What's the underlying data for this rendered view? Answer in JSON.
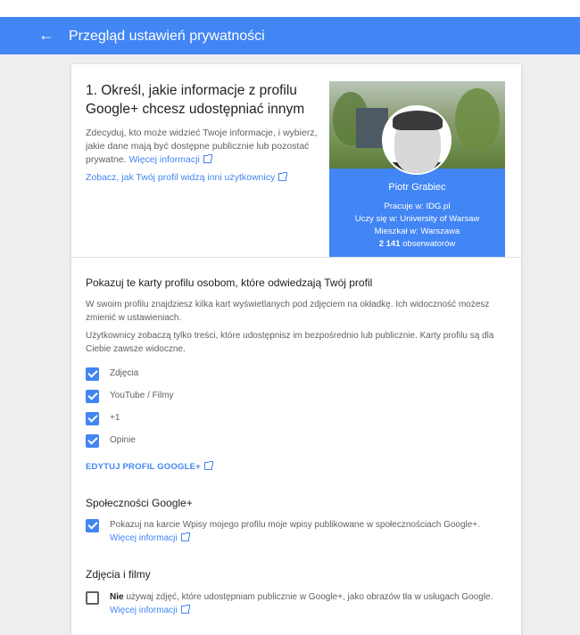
{
  "header": {
    "back_icon": "arrow-left-icon",
    "title": "Przegląd ustawień prywatności",
    "color": "#4285f4"
  },
  "section1": {
    "title": "1. Określ, jakie informacje z profilu Google+ chcesz udostępniać innym",
    "description": "Zdecyduj, kto może widzieć Twoje informacje, i wybierz, jakie dane mają być dostępne publicznie lub pozostać prywatne.",
    "more_link": "Więcej informacji",
    "view_link": "Zobacz, jak Twój profil widzą inni użytkownicy"
  },
  "profile_card": {
    "name": "Piotr Grabiec",
    "work": "Pracuje w: IDG.pl",
    "school": "Uczy się w: University of Warsaw",
    "lives": "Mieszkał w: Warszawa",
    "followers_count": "2 141",
    "followers_label": "obserwatorów"
  },
  "section2": {
    "title": "Pokazuj te karty profilu osobom, które odwiedzają Twój profil",
    "para1": "W swoim profilu znajdziesz kilka kart wyświetlanych pod zdjęciem na okładkę. Ich widoczność możesz zmienić w ustawieniach.",
    "para2": "Użytkownicy zobaczą tylko treści, które udostępnisz im bezpośrednio lub publicznie. Karty profilu są dla Ciebie zawsze widoczne.",
    "checkboxes": [
      {
        "label": "Zdjęcia",
        "checked": true
      },
      {
        "label": "YouTube / Filmy",
        "checked": true
      },
      {
        "label": "+1",
        "checked": true
      },
      {
        "label": "Opinie",
        "checked": true
      }
    ],
    "edit_link": "EDYTUJ PROFIL GOOGLE+"
  },
  "section3": {
    "title": "Społeczności Google+",
    "checkbox_text": "Pokazuj na karcie Wpisy mojego profilu moje wpisy publikowane w społecznościach Google+.",
    "checked": true,
    "more_link": "Więcej informacji"
  },
  "section4": {
    "title": "Zdjęcia i filmy",
    "checkbox_bold": "Nie",
    "checkbox_text": " używaj zdjęć, które udostępniam publicznie w Google+, jako obrazów tła w usługach Google.",
    "checked": false,
    "more_link": "Więcej informacji"
  }
}
